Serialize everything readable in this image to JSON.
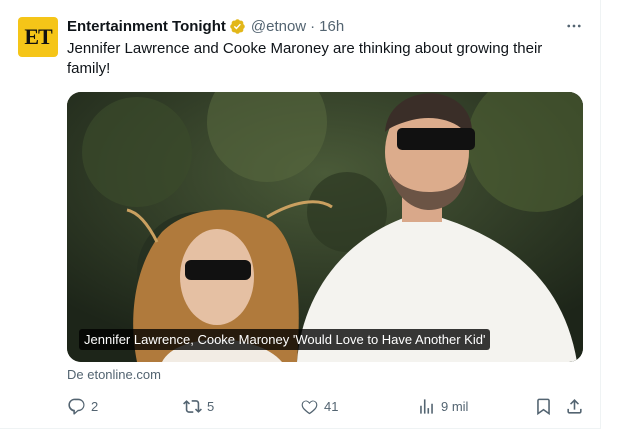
{
  "tweet": {
    "author": {
      "avatar_text": "ET",
      "display_name": "Entertainment Tonight",
      "handle": "@etnow",
      "separator": "·",
      "time": "16h",
      "verified_icon": "gold-verified-badge-icon"
    },
    "text": "Jennifer Lawrence and Cooke Maroney are thinking about growing their family!",
    "media": {
      "caption": "Jennifer Lawrence, Cooke Maroney 'Would Love to Have Another Kid'"
    },
    "source": "De etonline.com",
    "actions": {
      "replies": "2",
      "retweets": "5",
      "likes": "41",
      "views": "9 mil"
    }
  },
  "colors": {
    "text": "#0f1419",
    "secondary": "#536471",
    "verified_gold": "#e2b719",
    "avatar_bg": "#f5c518"
  },
  "icons": [
    "more-icon",
    "reply-icon",
    "retweet-icon",
    "like-icon",
    "views-icon",
    "bookmark-icon",
    "share-icon"
  ]
}
